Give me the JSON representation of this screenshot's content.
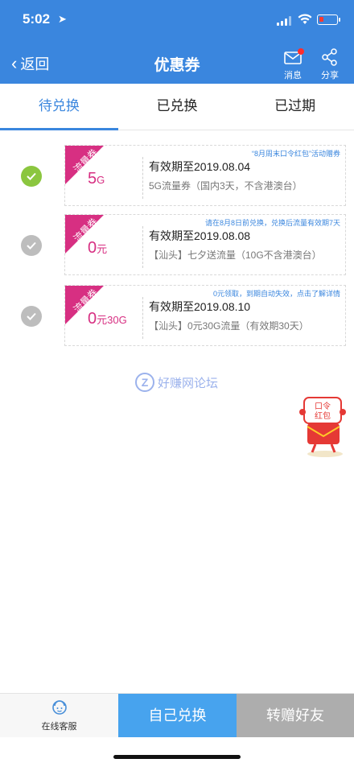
{
  "status_bar": {
    "time": "5:02",
    "location_icon": "location-arrow-icon"
  },
  "header": {
    "back_label": "返回",
    "title": "优惠券",
    "message_label": "消息",
    "share_label": "分享"
  },
  "tabs": [
    {
      "label": "待兑换",
      "active": true
    },
    {
      "label": "已兑换",
      "active": false
    },
    {
      "label": "已过期",
      "active": false
    }
  ],
  "coupons": [
    {
      "checked": true,
      "ribbon": "流量券",
      "amount_main": "5",
      "amount_unit": "G",
      "promo": "“8月周末口令红包”活动赠券",
      "validity": "有效期至2019.08.04",
      "desc": "5G流量券（国内3天，不含港澳台）"
    },
    {
      "checked": false,
      "ribbon": "流量券",
      "amount_main": "0",
      "amount_unit": "元",
      "promo": "请在8月8日前兑换，兑换后流量有效期7天",
      "validity": "有效期至2019.08.08",
      "desc": "【汕头】七夕送流量（10G不含港澳台）"
    },
    {
      "checked": false,
      "ribbon": "流量券",
      "amount_main": "0",
      "amount_unit": "元30G",
      "promo": "0元领取，到期自动失效，点击了解详情",
      "validity": "有效期至2019.08.10",
      "desc": "【汕头】0元30G流量（有效期30天）"
    }
  ],
  "watermark": {
    "text": "好赚网论坛",
    "logo_letter": "Z"
  },
  "mascot": {
    "text_line1": "口令",
    "text_line2": "红包"
  },
  "bottom_bar": {
    "service_label": "在线客服",
    "redeem_self_label": "自己兑换",
    "gift_friend_label": "转赠好友"
  },
  "colors": {
    "primary": "#3a86de",
    "coupon_accent": "#d72f82",
    "check_on": "#8bc63f",
    "check_off": "#bdbdbd",
    "redeem_button": "#47a3ee",
    "gift_button": "#adadad"
  }
}
